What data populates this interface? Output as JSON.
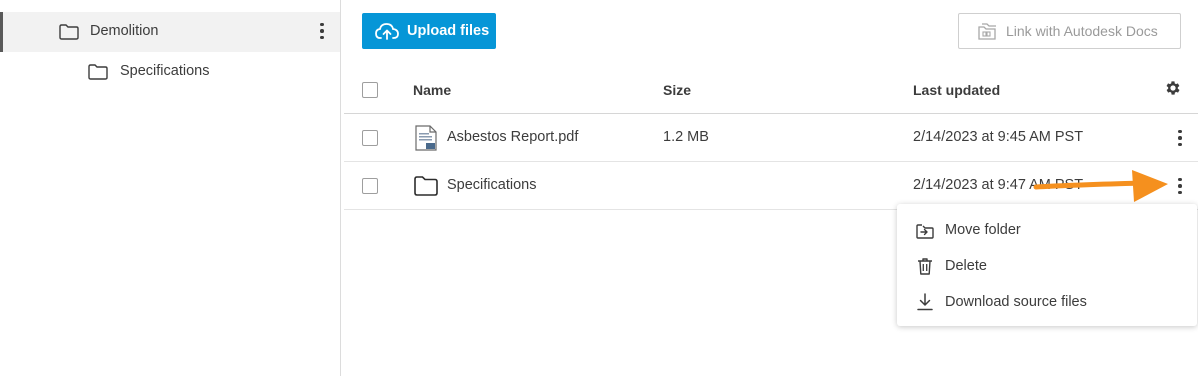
{
  "sidebar": {
    "items": [
      {
        "label": "Demolition",
        "selected": true,
        "icon": "folder-icon"
      },
      {
        "label": "Specifications",
        "selected": false,
        "icon": "folder-icon"
      }
    ]
  },
  "toolbar": {
    "upload_label": "Upload files",
    "upload_icon": "cloud-upload-icon",
    "link_label": "Link with Autodesk Docs",
    "link_icon": "docs-link-icon",
    "accent_color": "#0696d7"
  },
  "table": {
    "columns": {
      "name": "Name",
      "size": "Size",
      "updated": "Last updated"
    },
    "rows": [
      {
        "name": "Asbestos Report.pdf",
        "size": "1.2 MB",
        "updated": "2/14/2023 at 9:45 AM PST",
        "icon": "pdf-file-icon"
      },
      {
        "name": "Specifications",
        "size": "",
        "updated": "2/14/2023 at 9:47 AM PST",
        "icon": "folder-icon"
      }
    ]
  },
  "context_menu": {
    "items": [
      {
        "label": "Move folder",
        "icon": "move-folder-icon"
      },
      {
        "label": "Delete",
        "icon": "trash-icon"
      },
      {
        "label": "Download source files",
        "icon": "download-icon"
      }
    ]
  },
  "annotation": {
    "arrow_color": "#f5901e"
  }
}
